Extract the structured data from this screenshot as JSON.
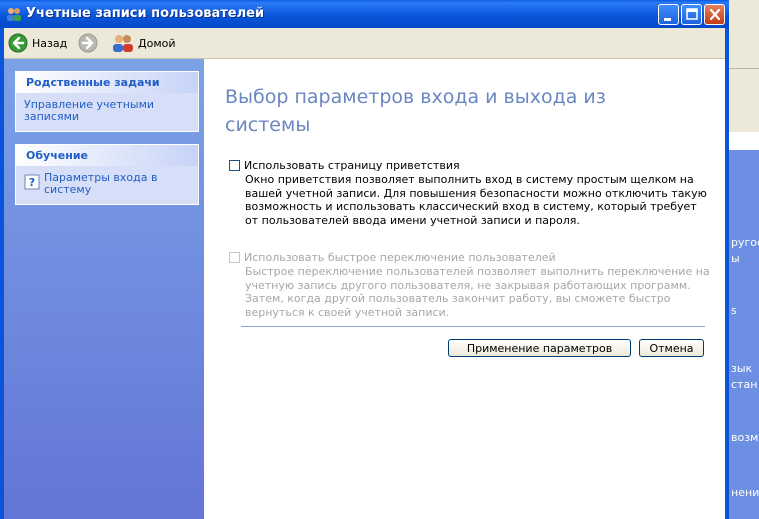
{
  "window": {
    "title": "Учетные записи пользователей",
    "icons": {
      "app": "users-icon",
      "minimize": "minimize-icon",
      "maximize": "maximize-icon",
      "close": "close-icon"
    },
    "accent_color": "#0a54dc"
  },
  "toolbar": {
    "back_label": "Назад",
    "forward_icon": "forward-arrow-icon",
    "home_label": "Домой"
  },
  "sidebar": {
    "related_tasks": {
      "title": "Родственные задачи",
      "links": [
        "Управление учетными записями"
      ]
    },
    "learning": {
      "title": "Обучение",
      "links": [
        "Параметры входа в систему"
      ]
    }
  },
  "main": {
    "heading": "Выбор параметров входа и выхода из системы",
    "option_welcome": {
      "label": "Использовать страницу приветствия",
      "checked": false,
      "enabled": true,
      "description": "Окно приветствия позволяет выполнить вход в систему простым щелком на вашей учетной записи. Для повышения безопасности можно отключить такую возможность и использовать классический вход в систему, который требует от пользователей ввода имени учетной записи и пароля."
    },
    "option_fast_switch": {
      "label": "Использовать быстрое переключение пользователей",
      "checked": false,
      "enabled": false,
      "description": "Быстрое переключение пользователей позволяет выполнить переключение на учетную запись другого пользователя, не закрывая работающих программ. Затем, когда другой пользователь закончит работу, вы сможете быстро вернуться к своей учетной записи."
    },
    "apply_button": "Применение параметров",
    "cancel_button": "Отмена"
  },
  "background_window": {
    "fragments": [
      "ругое",
      "ы",
      "s",
      "зык",
      "стан",
      "возм",
      "нения"
    ]
  }
}
